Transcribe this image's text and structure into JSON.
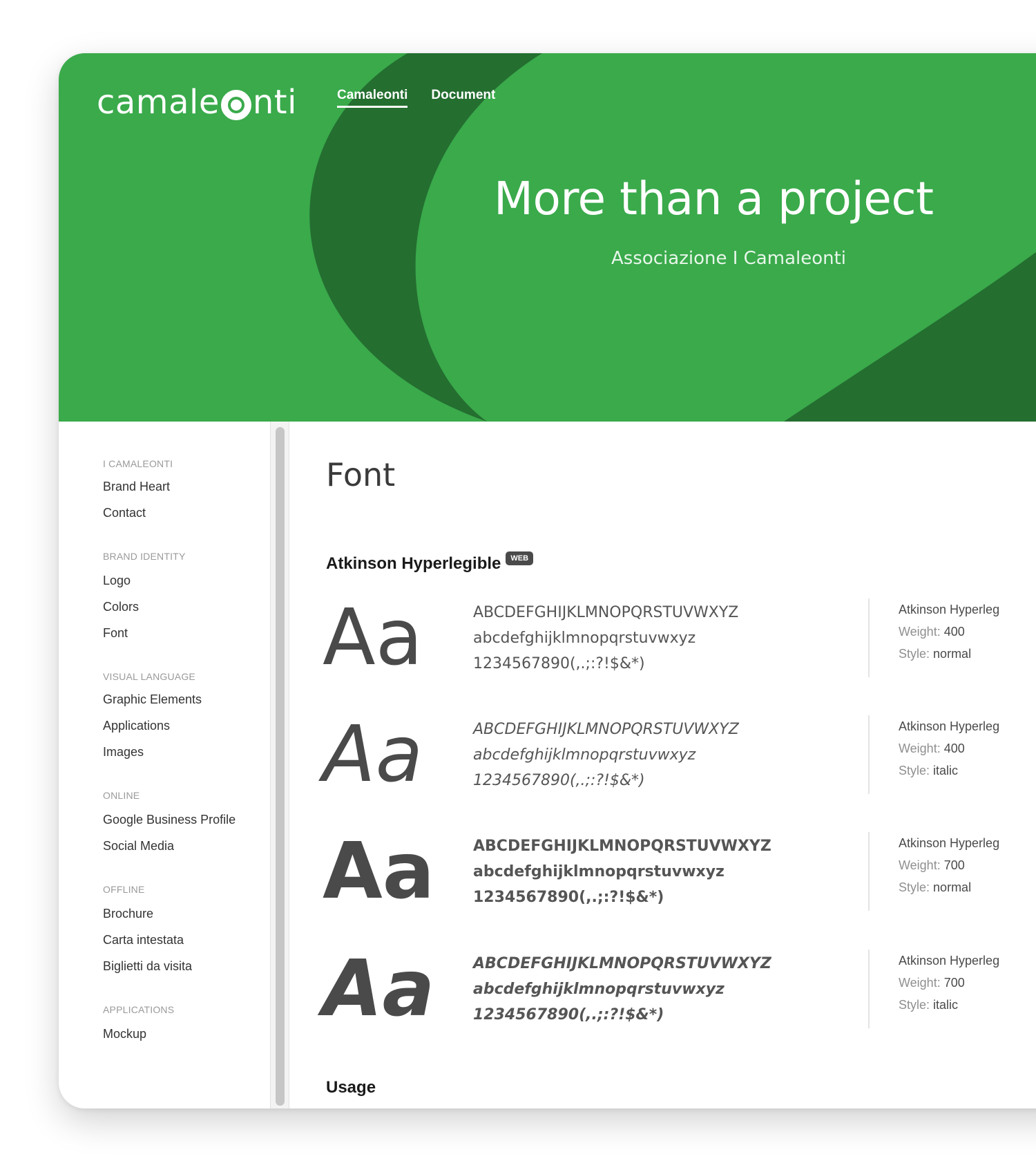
{
  "colors": {
    "brand_green": "#3aaa4b",
    "dark_green": "#246e30",
    "text": "#333333",
    "muted": "#9a9a9a"
  },
  "header": {
    "logo_left": "camale",
    "logo_right": "nti",
    "nav": [
      {
        "label": "Camaleonti",
        "active": true
      },
      {
        "label": "Document",
        "active": false
      }
    ],
    "title": "More than a project",
    "subtitle": "Associazione I Camaleonti"
  },
  "sidebar": {
    "groups": [
      {
        "heading": "I CAMALEONTI",
        "items": [
          "Brand Heart",
          "Contact"
        ]
      },
      {
        "heading": "BRAND IDENTITY",
        "items": [
          "Logo",
          "Colors",
          "Font"
        ]
      },
      {
        "heading": "VISUAL LANGUAGE",
        "items": [
          "Graphic Elements",
          "Applications",
          "Images"
        ]
      },
      {
        "heading": "ONLINE",
        "items": [
          "Google Business Profile",
          "Social Media"
        ]
      },
      {
        "heading": "OFFLINE",
        "items": [
          "Brochure",
          "Carta intestata",
          "Biglietti da visita"
        ]
      },
      {
        "heading": "APPLICATIONS",
        "items": [
          "Mockup"
        ]
      }
    ]
  },
  "main": {
    "page_title": "Font",
    "font_name": "Atkinson Hyperlegible",
    "badge": "WEB",
    "specimens": [
      {
        "sample": "Aa",
        "upper": "ABCDEFGHIJKLMNOPQRSTUVWXYZ",
        "lower": "abcdefghijklmnopqrstuvwxyz",
        "digits": "1234567890(,.;:?!$&*)",
        "meta_name": "Atkinson Hyperleg",
        "weight_label": "Weight:",
        "weight": "400",
        "style_label": "Style:",
        "style": "normal"
      },
      {
        "sample": "Aa",
        "upper": "ABCDEFGHIJKLMNOPQRSTUVWXYZ",
        "lower": "abcdefghijklmnopqrstuvwxyz",
        "digits": "1234567890(,.;:?!$&*)",
        "meta_name": "Atkinson Hyperleg",
        "weight_label": "Weight:",
        "weight": "400",
        "style_label": "Style:",
        "style": "italic"
      },
      {
        "sample": "Aa",
        "upper": "ABCDEFGHIJKLMNOPQRSTUVWXYZ",
        "lower": "abcdefghijklmnopqrstuvwxyz",
        "digits": "1234567890(,.;:?!$&*)",
        "meta_name": "Atkinson Hyperleg",
        "weight_label": "Weight:",
        "weight": "700",
        "style_label": "Style:",
        "style": "normal"
      },
      {
        "sample": "Aa",
        "upper": "ABCDEFGHIJKLMNOPQRSTUVWXYZ",
        "lower": "abcdefghijklmnopqrstuvwxyz",
        "digits": "1234567890(,.;:?!$&*)",
        "meta_name": "Atkinson Hyperleg",
        "weight_label": "Weight:",
        "weight": "700",
        "style_label": "Style:",
        "style": "italic"
      }
    ],
    "usage_heading": "Usage"
  }
}
